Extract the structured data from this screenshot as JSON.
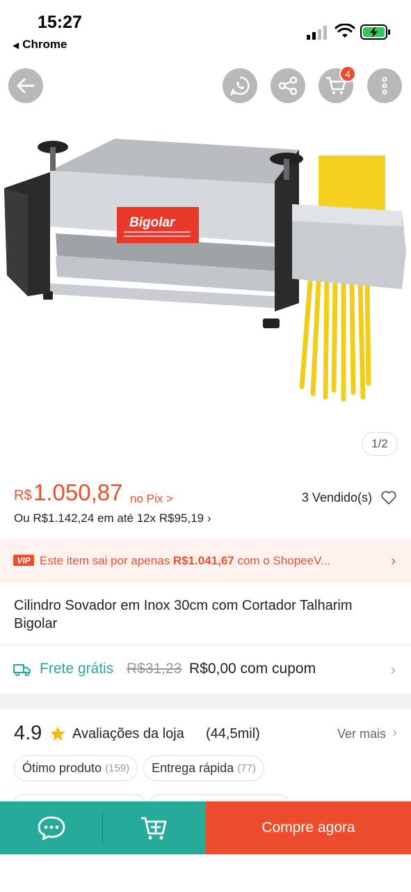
{
  "status_bar": {
    "time": "15:27",
    "back_app": "Chrome",
    "back_glyph": "◀"
  },
  "nav": {
    "cart_count": "4"
  },
  "gallery": {
    "image_counter": "1/2",
    "brand_label": "Bigolar"
  },
  "price": {
    "currency": "R$",
    "amount": "1.050,87",
    "pix_label": "no Pix >",
    "sold": "3 Vendido(s)",
    "installments": "Ou R$1.142,24 em até 12x R$95,19 ›"
  },
  "vip": {
    "badge": "VIP",
    "text_prefix": "Este item sai por apenas ",
    "text_price": "R$1.041,67",
    "text_suffix": " com o ShopeeV...",
    "chevron": "›"
  },
  "product": {
    "title": "Cilindro Sovador em Inox 30cm com Cortador Talharim Bigolar"
  },
  "shipping": {
    "label": "Frete grátis",
    "old_price": "R$31,23",
    "new_price": "R$0,00 com cupom",
    "chevron": "›"
  },
  "store_rating": {
    "score": "4.9",
    "label": "Avaliações da loja",
    "count": "(44,5mil)",
    "see_more": "Ver mais",
    "chevron": "›"
  },
  "tags": [
    {
      "label": "Ótimo produto",
      "count": "(159)"
    },
    {
      "label": "Entrega rápida",
      "count": "(77)"
    }
  ],
  "bottom_bar": {
    "buy_now": "Compre agora"
  },
  "colors": {
    "accent": "#ee4d2d",
    "teal": "#26aa99",
    "vip_bg": "#fff2ee"
  }
}
